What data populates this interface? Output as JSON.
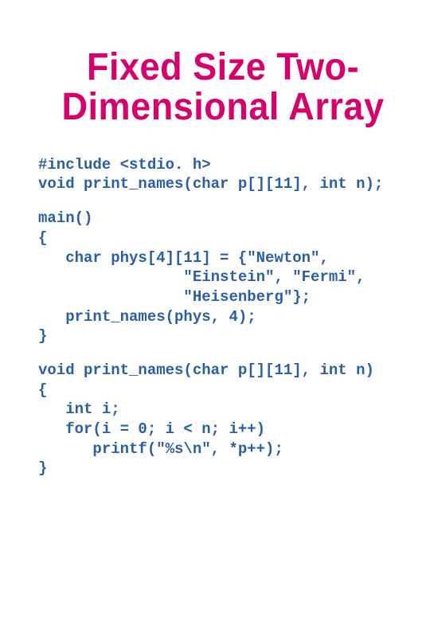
{
  "title": "Fixed Size Two-Dimensional Array",
  "code": {
    "block1": "#include <stdio. h>\nvoid print_names(char p[][11], int n);",
    "block2": "main()\n{\n   char phys[4][11] = {\"Newton\",\n                \"Einstein\", \"Fermi\",\n                \"Heisenberg\"};\n   print_names(phys, 4);\n}",
    "block3": "void print_names(char p[][11], int n)\n{\n   int i;\n   for(i = 0; i < n; i++)\n      printf(\"%s\\n\", *p++);\n}"
  }
}
